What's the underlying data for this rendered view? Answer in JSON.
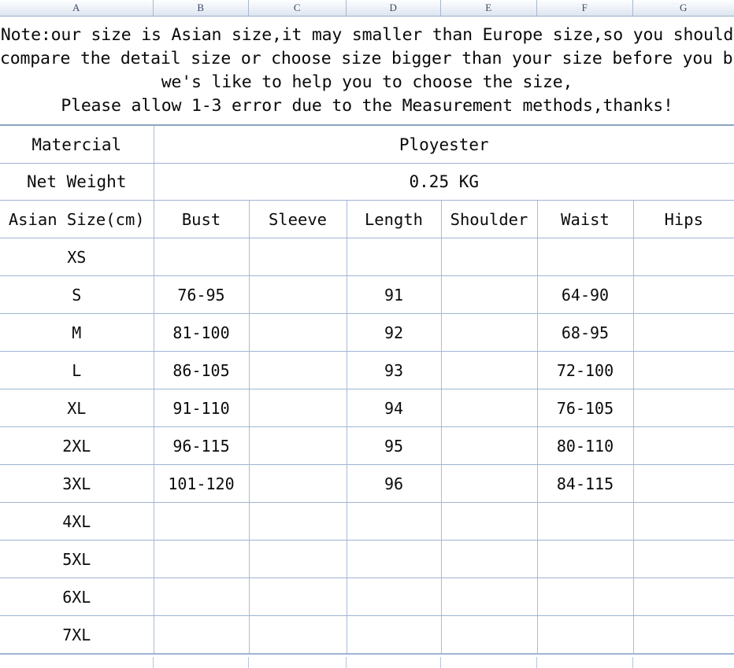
{
  "spreadsheet": {
    "column_headers": [
      "A",
      "B",
      "C",
      "D",
      "E",
      "F",
      "G"
    ]
  },
  "note": {
    "lines": [
      "Note:our size is Asian size,it may smaller than Europe size,so you should",
      "compare the detail size or choose size bigger than your size before you buy,",
      "we's like to help you to choose the size,",
      "Please allow 1-3 error due to the Measurement methods,thanks!"
    ]
  },
  "info_rows": [
    {
      "label": "Matercial",
      "value": "Ployester"
    },
    {
      "label": "Net Weight",
      "value": "0.25 KG"
    }
  ],
  "size_table": {
    "headers": [
      "Asian Size(cm)",
      "Bust",
      "Sleeve",
      "Length",
      "Shoulder",
      "Waist",
      "Hips"
    ],
    "rows": [
      {
        "size": "XS",
        "bust": "",
        "sleeve": "",
        "length": "",
        "shoulder": "",
        "waist": "",
        "hips": ""
      },
      {
        "size": "S",
        "bust": "76-95",
        "sleeve": "",
        "length": "91",
        "shoulder": "",
        "waist": "64-90",
        "hips": ""
      },
      {
        "size": "M",
        "bust": "81-100",
        "sleeve": "",
        "length": "92",
        "shoulder": "",
        "waist": "68-95",
        "hips": ""
      },
      {
        "size": "L",
        "bust": "86-105",
        "sleeve": "",
        "length": "93",
        "shoulder": "",
        "waist": "72-100",
        "hips": ""
      },
      {
        "size": "XL",
        "bust": "91-110",
        "sleeve": "",
        "length": "94",
        "shoulder": "",
        "waist": "76-105",
        "hips": ""
      },
      {
        "size": "2XL",
        "bust": "96-115",
        "sleeve": "",
        "length": "95",
        "shoulder": "",
        "waist": "80-110",
        "hips": ""
      },
      {
        "size": "3XL",
        "bust": "101-120",
        "sleeve": "",
        "length": "96",
        "shoulder": "",
        "waist": "84-115",
        "hips": ""
      },
      {
        "size": "4XL",
        "bust": "",
        "sleeve": "",
        "length": "",
        "shoulder": "",
        "waist": "",
        "hips": ""
      },
      {
        "size": "5XL",
        "bust": "",
        "sleeve": "",
        "length": "",
        "shoulder": "",
        "waist": "",
        "hips": ""
      },
      {
        "size": "6XL",
        "bust": "",
        "sleeve": "",
        "length": "",
        "shoulder": "",
        "waist": "",
        "hips": ""
      },
      {
        "size": "7XL",
        "bust": "",
        "sleeve": "",
        "length": "",
        "shoulder": "",
        "waist": "",
        "hips": ""
      }
    ]
  },
  "colors": {
    "grid_line": "#aabcd8",
    "header_text": "#3a4a63",
    "note_background": "#fdfdf8",
    "text": "#0b0b0b"
  }
}
